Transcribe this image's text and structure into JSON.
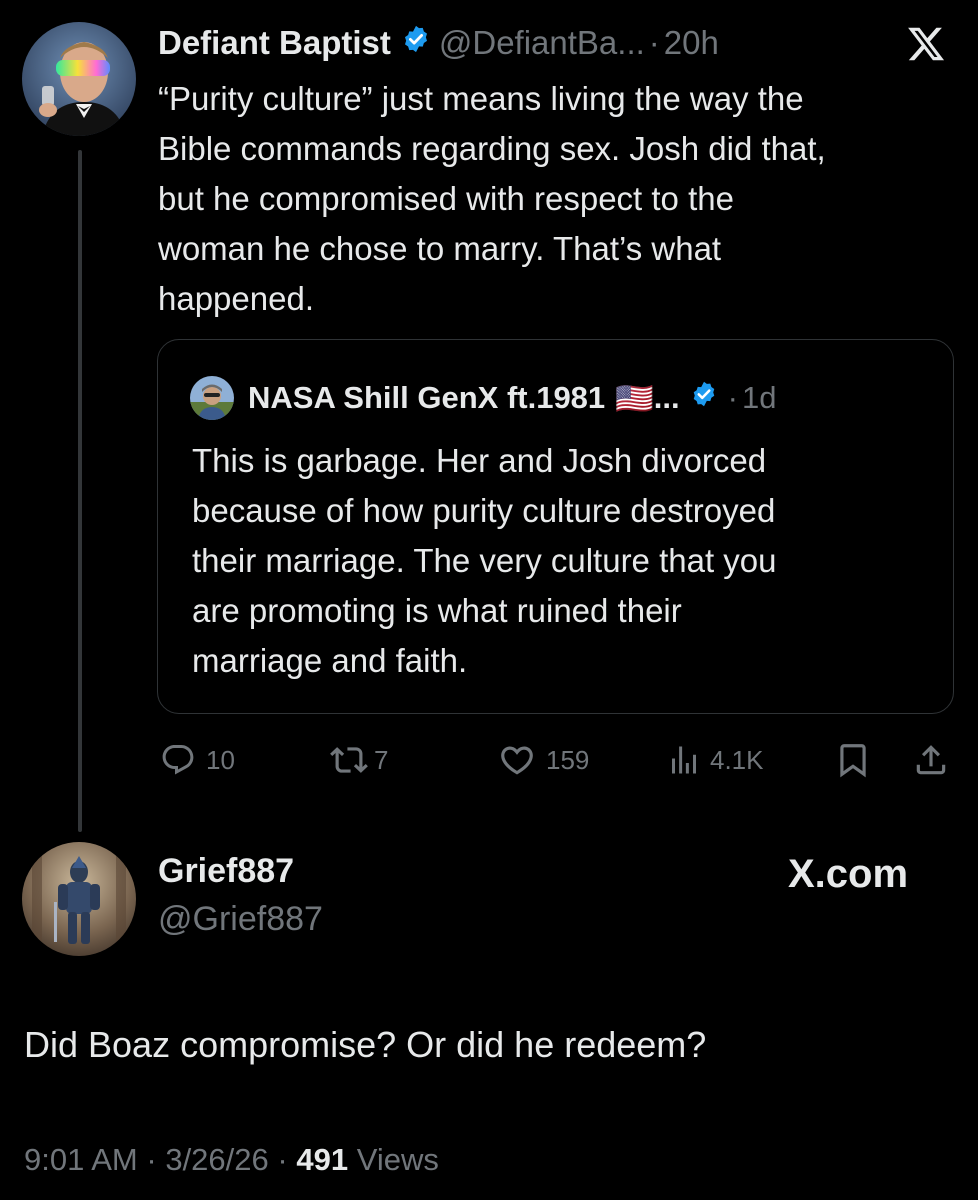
{
  "parent_tweet": {
    "author_name": "Defiant Baptist",
    "handle": "@DefiantBa...",
    "separator": "·",
    "time": "20h",
    "text": "“Purity culture” just means living the way the\nBible commands regarding sex. Josh did that,\nbut he compromised with respect to the\nwoman he chose to marry. That’s what\nhappened.",
    "verified_icon": "verified-badge-icon",
    "logo_icon": "x-logo-icon"
  },
  "quoted_tweet": {
    "author_name": "NASA Shill GenX ft.1981",
    "flag": "🇺🇸",
    "ellipsis": "...",
    "separator": "·",
    "time": "1d",
    "text": "This is garbage. Her and Josh divorced\nbecause of how purity culture destroyed\ntheir marriage. The very culture that you\nare promoting is what ruined their\nmarriage and faith."
  },
  "actions": {
    "replies": "10",
    "reposts": "7",
    "likes": "159",
    "views": "4.1K"
  },
  "reply": {
    "author_name": "Grief887",
    "handle": "@Grief887",
    "watermark": "X.com",
    "text": "Did Boaz compromise? Or did he redeem?",
    "time": "9:01 AM",
    "sep1": "·",
    "date": "3/26/26",
    "sep2": "·",
    "views_count": "491",
    "views_label": "Views"
  },
  "colors": {
    "background": "#000000",
    "text": "#e7e9ea",
    "muted": "#71767b",
    "verified": "#1d9bf0",
    "border": "#2f3336"
  }
}
